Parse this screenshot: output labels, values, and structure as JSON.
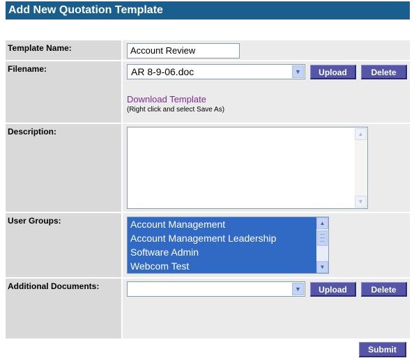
{
  "page": {
    "title": "Add New Quotation Template"
  },
  "form": {
    "template_name": {
      "label": "Template Name:",
      "value": "Account Review"
    },
    "filename": {
      "label": "Filename:",
      "selected": "AR 8-9-06.doc",
      "upload_label": "Upload",
      "delete_label": "Delete",
      "download_link": "Download Template",
      "download_hint": "(Right click and select Save As)"
    },
    "description": {
      "label": "Description:",
      "value": ""
    },
    "user_groups": {
      "label": "User Groups:",
      "options": [
        "Account Management",
        "Account Management Leadership",
        "Software Admin",
        "Webcom Test"
      ]
    },
    "additional_documents": {
      "label": "Additional Documents:",
      "selected": "",
      "upload_label": "Upload",
      "delete_label": "Delete"
    },
    "submit_label": "Submit"
  },
  "colors": {
    "title_bar": "#1a5e8e",
    "button": "#5656a8",
    "label_bg": "#d9d9d9",
    "value_bg": "#ebebeb",
    "selection": "#316ac5",
    "link": "#7a2f8e"
  },
  "icons": {
    "select_arrow": "chevron-down-icon",
    "scroll_up": "scroll-up-icon",
    "scroll_down": "scroll-down-icon"
  }
}
